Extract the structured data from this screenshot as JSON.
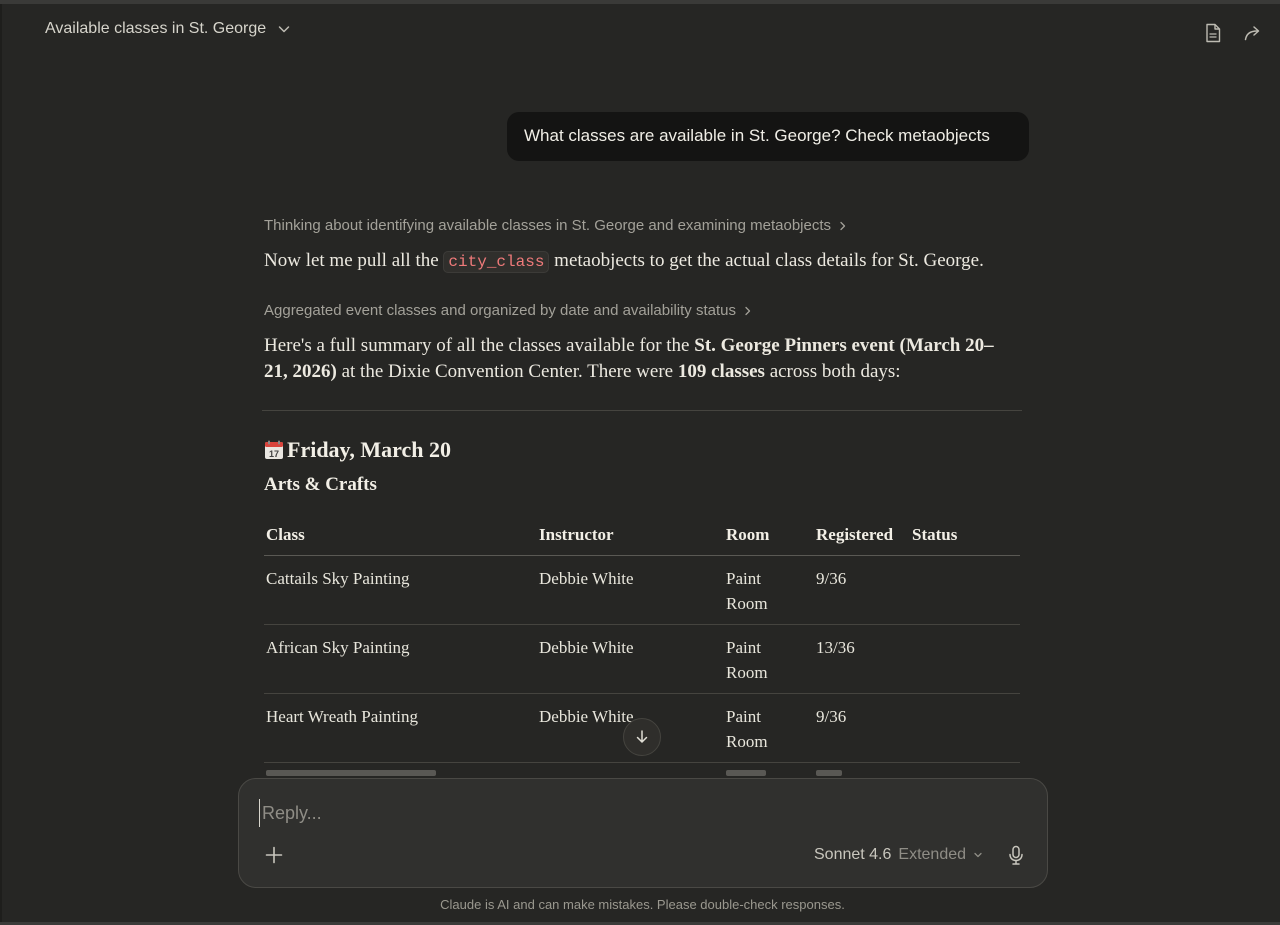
{
  "header": {
    "title": "Available classes in St. George",
    "icons": [
      "document-icon",
      "share-icon"
    ]
  },
  "user_message": "What classes are available in St. George? Check metaobjects",
  "assistant": {
    "thinking_1": "Thinking about identifying available classes in St. George and examining metaobjects",
    "para1_pre": "Now let me pull all the",
    "para1_code": "city_class",
    "para1_post": "metaobjects to get the actual class details for St. George.",
    "thinking_2": "Aggregated event classes and organized by date and availability status",
    "summary": {
      "t1": "Here's a full summary of all the classes available for the",
      "b1": "St. George Pinners event (March 20–21, 2026)",
      "t2": "at the Dixie Convention Center. There were",
      "b2": "109 classes",
      "t3": "across both days:"
    },
    "day_heading": "Friday, March 20",
    "category_heading": "Arts & Crafts",
    "table": {
      "headers": [
        "Class",
        "Instructor",
        "Room",
        "Registered",
        "Status"
      ],
      "rows": [
        [
          "Cattails Sky Painting",
          "Debbie White",
          "Paint Room",
          "9/36",
          ""
        ],
        [
          "African Sky Painting",
          "Debbie White",
          "Paint Room",
          "13/36",
          ""
        ],
        [
          "Heart Wreath Painting",
          "Debbie White",
          "Paint Room",
          "9/36",
          ""
        ]
      ]
    }
  },
  "composer": {
    "placeholder": "Reply...",
    "model": "Sonnet 4.6",
    "mode": "Extended"
  },
  "disclaimer": "Claude is AI and can make mistakes. Please double-check responses.",
  "colors": {
    "background": "#262624",
    "bubble": "#141413",
    "code": "#ef7a7a",
    "composer": "#30302e"
  }
}
